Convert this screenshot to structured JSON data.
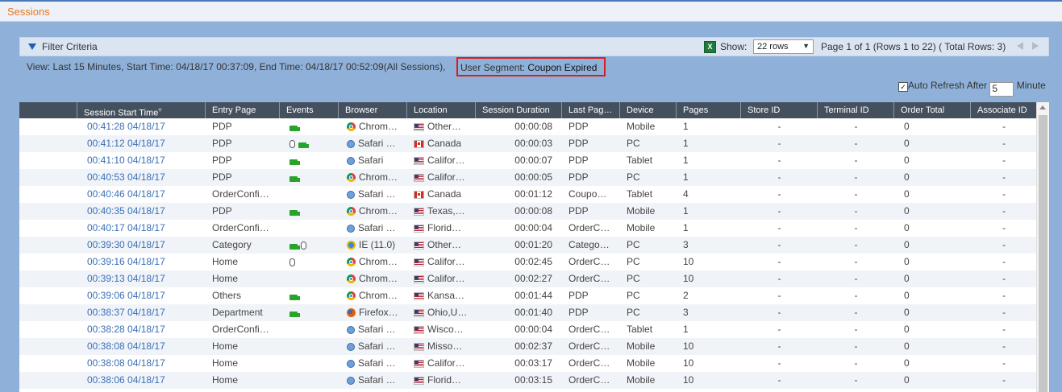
{
  "header": {
    "title": "Sessions"
  },
  "filter": {
    "title": "Filter Criteria",
    "show_label": "Show:",
    "rows_selected": "22 rows",
    "page_info": "Page 1 of 1 (Rows 1 to 22) ( Total Rows: 3)"
  },
  "view": {
    "text": "View: Last 15 Minutes, Start Time: 04/18/17 00:37:09, End Time: 04/18/17 00:52:09(All Sessions),",
    "segment_label": "User Segment:",
    "segment_value": "Coupon Expired"
  },
  "auto_refresh": {
    "label": "Auto Refresh After",
    "value": "5",
    "unit": "Minute",
    "checked": true
  },
  "columns": [
    {
      "key": "blank",
      "label": ""
    },
    {
      "key": "start",
      "label": "Session Start Time"
    },
    {
      "key": "entry",
      "label": "Entry Page"
    },
    {
      "key": "events",
      "label": "Events"
    },
    {
      "key": "browser",
      "label": "Browser"
    },
    {
      "key": "location",
      "label": "Location"
    },
    {
      "key": "duration",
      "label": "Session Duration"
    },
    {
      "key": "last",
      "label": "Last Pag…"
    },
    {
      "key": "device",
      "label": "Device"
    },
    {
      "key": "pages",
      "label": "Pages"
    },
    {
      "key": "store",
      "label": "Store ID"
    },
    {
      "key": "terminal",
      "label": "Terminal ID"
    },
    {
      "key": "order",
      "label": "Order Total"
    },
    {
      "key": "associate",
      "label": "Associate ID"
    }
  ],
  "rows": [
    {
      "start": "00:41:28 04/18/17",
      "entry": "PDP",
      "events": [
        "truck-icon"
      ],
      "browser_icon": "chrome-icon",
      "browser": "Chrom…",
      "flag": "flag-us",
      "location": "Other…",
      "duration": "00:00:08",
      "last": "PDP",
      "device": "Mobile",
      "pages": "1",
      "store": "-",
      "terminal": "-",
      "order": "0",
      "associate": "-"
    },
    {
      "start": "00:41:12 04/18/17",
      "entry": "PDP",
      "events": [
        "mouse-icon",
        "truck-icon"
      ],
      "browser_icon": "safari-icon",
      "browser": "Safari …",
      "flag": "flag-ca",
      "location": "Canada",
      "duration": "00:00:03",
      "last": "PDP",
      "device": "PC",
      "pages": "1",
      "store": "-",
      "terminal": "-",
      "order": "0",
      "associate": "-"
    },
    {
      "start": "00:41:10 04/18/17",
      "entry": "PDP",
      "events": [
        "truck-icon"
      ],
      "browser_icon": "safari-icon",
      "browser": "Safari",
      "flag": "flag-us",
      "location": "Califor…",
      "duration": "00:00:07",
      "last": "PDP",
      "device": "Tablet",
      "pages": "1",
      "store": "-",
      "terminal": "-",
      "order": "0",
      "associate": "-"
    },
    {
      "start": "00:40:53 04/18/17",
      "entry": "PDP",
      "events": [
        "truck-icon"
      ],
      "browser_icon": "chrome-icon",
      "browser": "Chrom…",
      "flag": "flag-us",
      "location": "Califor…",
      "duration": "00:00:05",
      "last": "PDP",
      "device": "PC",
      "pages": "1",
      "store": "-",
      "terminal": "-",
      "order": "0",
      "associate": "-"
    },
    {
      "start": "00:40:46 04/18/17",
      "entry": "OrderConfi…",
      "events": [],
      "browser_icon": "safari-icon",
      "browser": "Safari …",
      "flag": "flag-ca",
      "location": "Canada",
      "duration": "00:01:12",
      "last": "Coupo…",
      "device": "Tablet",
      "pages": "4",
      "store": "-",
      "terminal": "-",
      "order": "0",
      "associate": "-"
    },
    {
      "start": "00:40:35 04/18/17",
      "entry": "PDP",
      "events": [
        "truck-icon"
      ],
      "browser_icon": "chrome-icon",
      "browser": "Chrom…",
      "flag": "flag-us",
      "location": "Texas,…",
      "duration": "00:00:08",
      "last": "PDP",
      "device": "Mobile",
      "pages": "1",
      "store": "-",
      "terminal": "-",
      "order": "0",
      "associate": "-"
    },
    {
      "start": "00:40:17 04/18/17",
      "entry": "OrderConfi…",
      "events": [],
      "browser_icon": "safari-icon",
      "browser": "Safari …",
      "flag": "flag-us",
      "location": "Florid…",
      "duration": "00:00:04",
      "last": "OrderC…",
      "device": "Mobile",
      "pages": "1",
      "store": "-",
      "terminal": "-",
      "order": "0",
      "associate": "-"
    },
    {
      "start": "00:39:30 04/18/17",
      "entry": "Category",
      "events": [
        "truck-icon",
        "mouse-icon"
      ],
      "browser_icon": "ie-icon",
      "browser": "IE (11.0)",
      "flag": "flag-us",
      "location": "Other…",
      "duration": "00:01:20",
      "last": "Catego…",
      "device": "PC",
      "pages": "3",
      "store": "-",
      "terminal": "-",
      "order": "0",
      "associate": "-"
    },
    {
      "start": "00:39:16 04/18/17",
      "entry": "Home",
      "events": [
        "mouse-icon"
      ],
      "browser_icon": "chrome-icon",
      "browser": "Chrom…",
      "flag": "flag-us",
      "location": "Califor…",
      "duration": "00:02:45",
      "last": "OrderC…",
      "device": "PC",
      "pages": "10",
      "store": "-",
      "terminal": "-",
      "order": "0",
      "associate": "-"
    },
    {
      "start": "00:39:13 04/18/17",
      "entry": "Home",
      "events": [],
      "browser_icon": "chrome-icon",
      "browser": "Chrom…",
      "flag": "flag-us",
      "location": "Califor…",
      "duration": "00:02:27",
      "last": "OrderC…",
      "device": "PC",
      "pages": "10",
      "store": "-",
      "terminal": "-",
      "order": "0",
      "associate": "-"
    },
    {
      "start": "00:39:06 04/18/17",
      "entry": "Others",
      "events": [
        "truck-icon"
      ],
      "browser_icon": "chrome-icon",
      "browser": "Chrom…",
      "flag": "flag-us",
      "location": "Kansa…",
      "duration": "00:01:44",
      "last": "PDP",
      "device": "PC",
      "pages": "2",
      "store": "-",
      "terminal": "-",
      "order": "0",
      "associate": "-"
    },
    {
      "start": "00:38:37 04/18/17",
      "entry": "Department",
      "events": [
        "truck-icon"
      ],
      "browser_icon": "firefox-icon",
      "browser": "Firefox…",
      "flag": "flag-us",
      "location": "Ohio,U…",
      "duration": "00:01:40",
      "last": "PDP",
      "device": "PC",
      "pages": "3",
      "store": "-",
      "terminal": "-",
      "order": "0",
      "associate": "-"
    },
    {
      "start": "00:38:28 04/18/17",
      "entry": "OrderConfi…",
      "events": [],
      "browser_icon": "safari-icon",
      "browser": "Safari …",
      "flag": "flag-us",
      "location": "Wisco…",
      "duration": "00:00:04",
      "last": "OrderC…",
      "device": "Tablet",
      "pages": "1",
      "store": "-",
      "terminal": "-",
      "order": "0",
      "associate": "-"
    },
    {
      "start": "00:38:08 04/18/17",
      "entry": "Home",
      "events": [],
      "browser_icon": "safari-icon",
      "browser": "Safari …",
      "flag": "flag-us",
      "location": "Misso…",
      "duration": "00:02:37",
      "last": "OrderC…",
      "device": "Mobile",
      "pages": "10",
      "store": "-",
      "terminal": "-",
      "order": "0",
      "associate": "-"
    },
    {
      "start": "00:38:08 04/18/17",
      "entry": "Home",
      "events": [],
      "browser_icon": "safari-icon",
      "browser": "Safari …",
      "flag": "flag-us",
      "location": "Califor…",
      "duration": "00:03:17",
      "last": "OrderC…",
      "device": "Mobile",
      "pages": "10",
      "store": "-",
      "terminal": "-",
      "order": "0",
      "associate": "-"
    },
    {
      "start": "00:38:06 04/18/17",
      "entry": "Home",
      "events": [],
      "browser_icon": "safari-icon",
      "browser": "Safari …",
      "flag": "flag-us",
      "location": "Florid…",
      "duration": "00:03:15",
      "last": "OrderC…",
      "device": "Mobile",
      "pages": "10",
      "store": "-",
      "terminal": "-",
      "order": "0",
      "associate": "-"
    }
  ]
}
